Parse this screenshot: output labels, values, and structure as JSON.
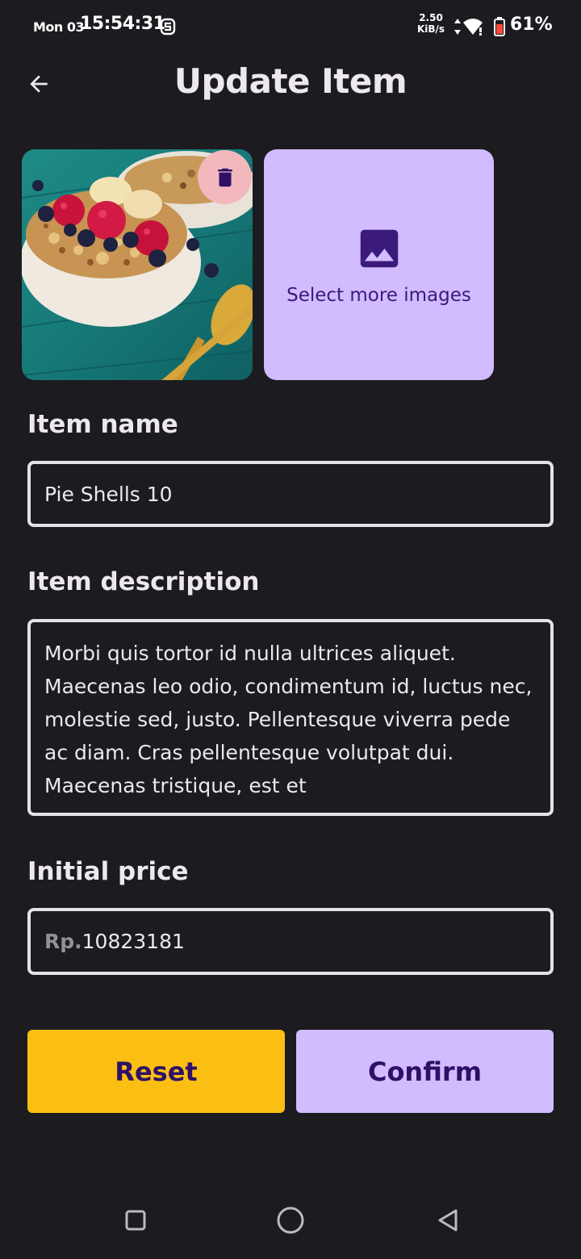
{
  "status_bar": {
    "day": "Mon 03",
    "time": "15:54:31",
    "speed_value": "2.50",
    "speed_unit": "KiB/s",
    "battery_pct": "61%"
  },
  "header": {
    "title": "Update Item"
  },
  "images": {
    "select_more_label": "Select more images"
  },
  "form": {
    "name_label": "Item name",
    "name_value": "Pie Shells 10",
    "description_label": "Item description",
    "description_value": "Morbi quis tortor id nulla ultrices aliquet. Maecenas leo odio, condimentum id, luctus nec, molestie sed, justo. Pellentesque viverra pede ac diam. Cras pellentesque volutpat dui. Maecenas tristique, est et",
    "price_label": "Initial price",
    "price_prefix": "Rp.",
    "price_value": "10823181"
  },
  "buttons": {
    "reset_label": "Reset",
    "confirm_label": "Confirm"
  },
  "colors": {
    "background": "#1c1b20",
    "primary_container": "#d0bcff",
    "reset_yellow": "#fbbf14",
    "delete_bg": "#f2b8bd",
    "on_primary": "#2e1166"
  },
  "icons": [
    "back-arrow-icon",
    "trash-icon",
    "image-icon",
    "nav-square-icon",
    "nav-circle-icon",
    "nav-triangle-icon"
  ]
}
